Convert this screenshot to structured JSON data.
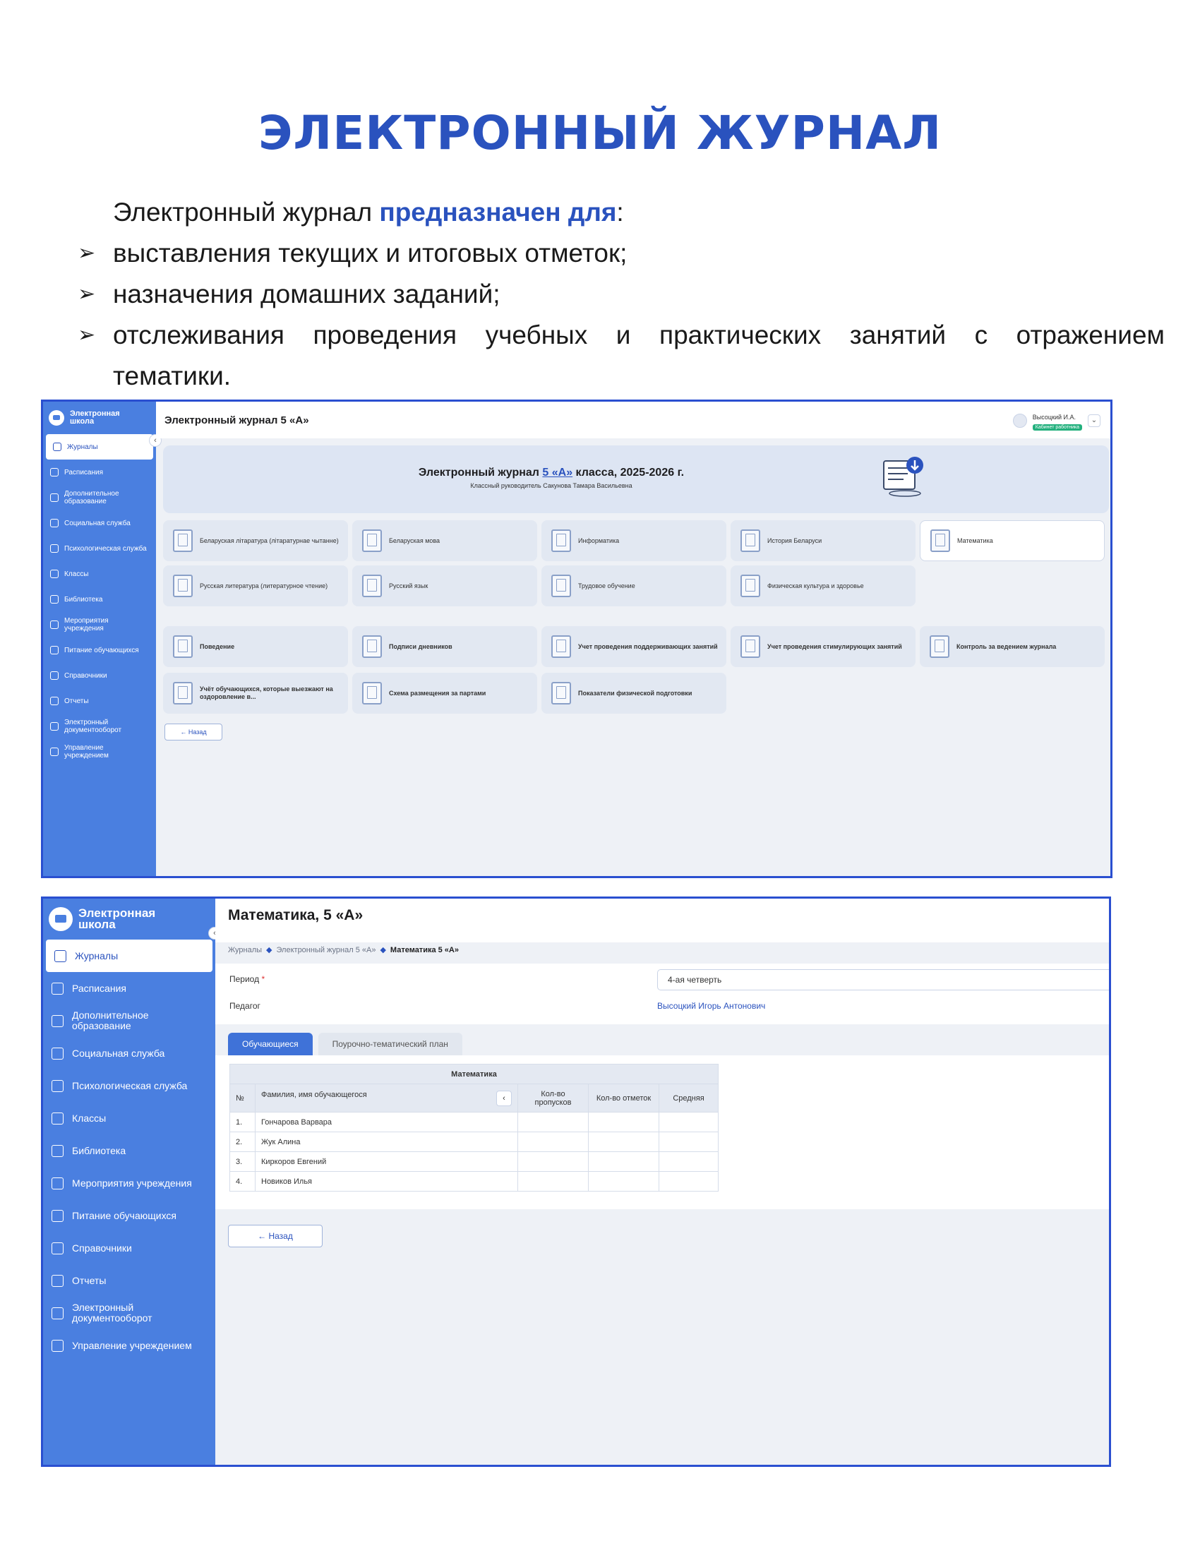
{
  "document": {
    "title": "ЭЛЕКТРОННЫЙ ЖУРНАЛ",
    "intro_prefix": "Электронный журнал ",
    "intro_highlight": "предназначен для",
    "intro_suffix": ":",
    "bullets": [
      "выставления текущих и итоговых отметок;",
      "назначения домашних заданий;",
      "отслеживания проведения учебных и практических занятий с отражением",
      "тематики."
    ]
  },
  "sidebar": {
    "logo_line1": "Электронная",
    "logo_line2": "школа",
    "items": [
      {
        "label": "Журналы",
        "icon": "journal-icon"
      },
      {
        "label": "Расписания",
        "icon": "calendar-icon"
      },
      {
        "label": "Дополнительное образование",
        "icon": "star-icon"
      },
      {
        "label": "Социальная служба",
        "icon": "people-icon"
      },
      {
        "label": "Психологическая служба",
        "icon": "psychology-icon"
      },
      {
        "label": "Классы",
        "icon": "class-icon"
      },
      {
        "label": "Библиотека",
        "icon": "library-icon"
      },
      {
        "label": "Мероприятия учреждения",
        "icon": "events-icon"
      },
      {
        "label": "Питание обучающихся",
        "icon": "food-icon"
      },
      {
        "label": "Справочники",
        "icon": "book-icon"
      },
      {
        "label": "Отчеты",
        "icon": "report-icon"
      },
      {
        "label": "Электронный документооборот",
        "icon": "folder-icon"
      },
      {
        "label": "Управление учреждением",
        "icon": "building-icon"
      }
    ]
  },
  "screen1": {
    "topbar_title": "Электронный журнал 5 «А»",
    "user_name": "Высоцкий И.А.",
    "user_badge": "Кабинет работника",
    "banner_title_prefix": "Электронный журнал ",
    "banner_title_link": "5 «А»",
    "banner_title_suffix": " класса, 2025-2026 г.",
    "banner_subtitle": "Классный руководитель Сакунова Тамара Васильевна",
    "subjects": [
      "Беларуская літаратура (літаратурнае чытанне)",
      "Беларуская мова",
      "Информатика",
      "История Беларуси",
      "Математика",
      "Русская литература (литературное чтение)",
      "Русский язык",
      "Трудовое обучение",
      "Физическая культура и здоровье"
    ],
    "extras": [
      "Поведение",
      "Подписи дневников",
      "Учет проведения поддерживающих занятий",
      "Учет проведения стимулирующих занятий",
      "Контроль за ведением журнала",
      "Учёт обучающихся, которые выезжают на оздоровление в...",
      "Схема размещения за партами",
      "Показатели физической подготовки"
    ],
    "back_label": "← Назад"
  },
  "screen2": {
    "title": "Математика, 5 «А»",
    "breadcrumb": [
      "Журналы",
      "Электронный журнал 5 «А»",
      "Математика 5 «А»"
    ],
    "period_label": "Период",
    "period_required": "*",
    "period_value": "4-ая четверть",
    "teacher_label": "Педагог",
    "teacher_value": "Высоцкий Игорь Антонович",
    "tabs": [
      "Обучающиеся",
      "Поурочно-тематический план"
    ],
    "table_caption": "Математика",
    "columns": {
      "num": "№",
      "name": "Фамилия, имя обучающегося",
      "absences": "Кол-во пропусков",
      "marks": "Кол-во отметок",
      "average": "Средняя"
    },
    "rows": [
      {
        "num": "1.",
        "name": "Гончарова Варвара"
      },
      {
        "num": "2.",
        "name": "Жук Алина"
      },
      {
        "num": "3.",
        "name": "Киркоров Евгений"
      },
      {
        "num": "4.",
        "name": "Новиков Илья"
      }
    ],
    "back_label": "← Назад"
  }
}
